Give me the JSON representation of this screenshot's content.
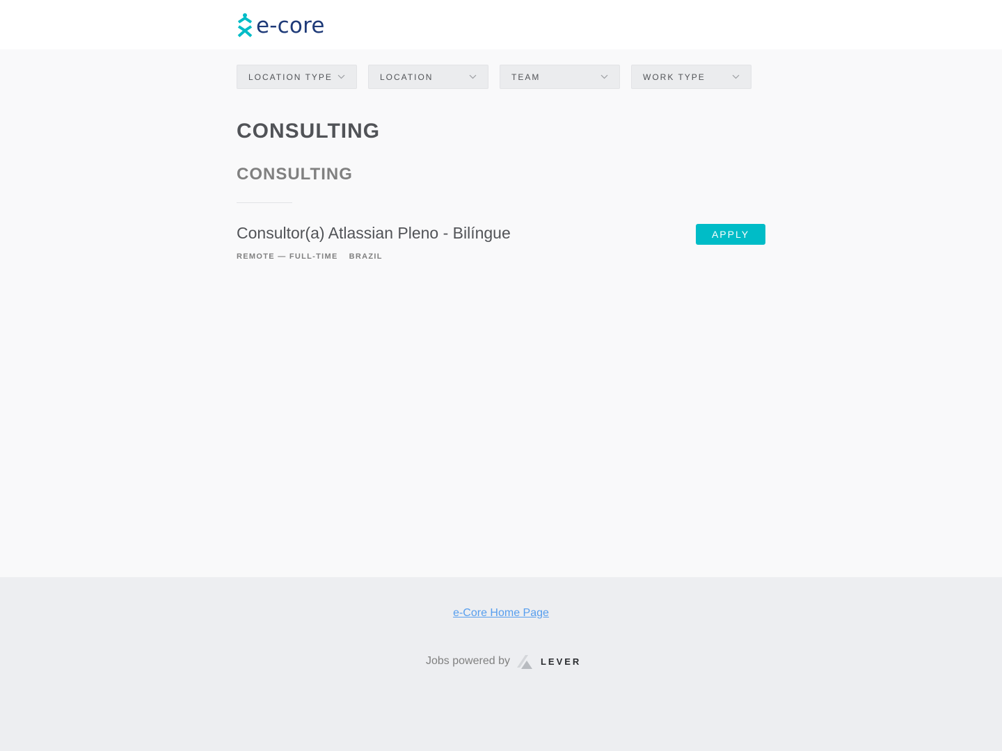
{
  "header": {
    "logo_text": "e-core"
  },
  "filters": [
    {
      "label": "LOCATION TYPE"
    },
    {
      "label": "LOCATION"
    },
    {
      "label": "TEAM"
    },
    {
      "label": "WORK TYPE"
    }
  ],
  "team": {
    "title": "CONSULTING",
    "subgroup": "CONSULTING"
  },
  "posting": {
    "title": "Consultor(a) Atlassian Pleno - Bilíngue",
    "commitment": "REMOTE — FULL-TIME",
    "location": "BRAZIL",
    "apply_label": "APPLY"
  },
  "footer": {
    "home_link": "e-Core Home Page",
    "powered_by": "Jobs powered by",
    "brand": "LEVER"
  },
  "colors": {
    "accent": "#00bcc7",
    "logo_text": "#1e3a78",
    "link": "#579eee"
  },
  "icons": [
    "ecore-logo-icon",
    "chevron-down-icon",
    "lever-logo-icon"
  ]
}
